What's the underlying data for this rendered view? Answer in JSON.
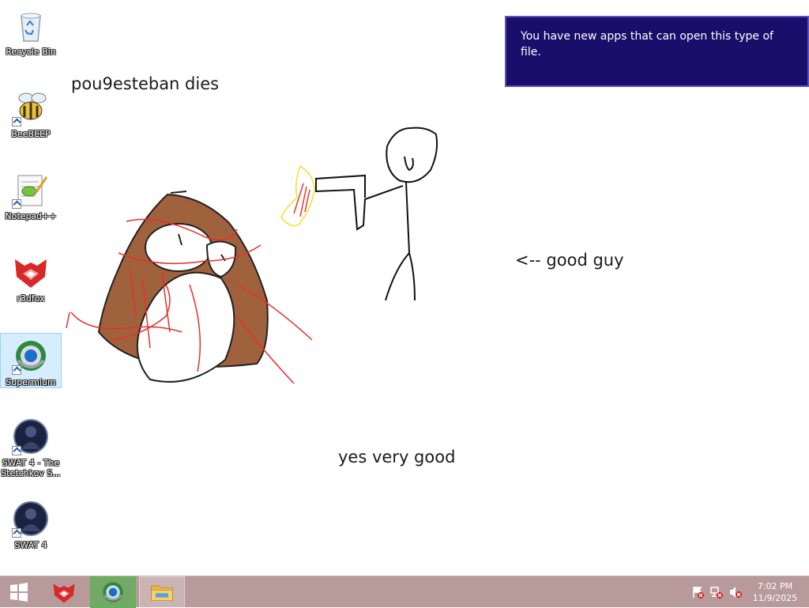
{
  "desktop": {
    "icons": [
      {
        "label": "Recycle Bin",
        "icon": "recycle-bin-icon"
      },
      {
        "label": "BeeBEEP",
        "icon": "bee-icon"
      },
      {
        "label": "Notepad++",
        "icon": "notepad-plus-plus-icon"
      },
      {
        "label": "r3dfox",
        "icon": "r3dfox-icon"
      },
      {
        "label": "Supermium",
        "icon": "supermium-icon"
      },
      {
        "label": "SWAT 4 - The Stetchkov S...",
        "icon": "swat4-stetchkov-icon"
      },
      {
        "label": "SWAT 4",
        "icon": "swat4-icon"
      }
    ]
  },
  "wallpaper": {
    "caption_top": "pou9esteban dies",
    "caption_right": "<-- good guy",
    "caption_bottom": "yes very good"
  },
  "toast": {
    "message": "You have new apps that can open this type of file."
  },
  "taskbar": {
    "start_icon": "windows-start-icon",
    "pinned": [
      "r3dfox-icon",
      "supermium-icon",
      "file-explorer-icon"
    ],
    "tray_icons": [
      "action-center-flag-icon",
      "network-icon",
      "volume-muted-icon"
    ],
    "time": "7:02 PM",
    "date": "11/9/2025"
  },
  "colors": {
    "taskbar": "#b89a9a",
    "toast_bg": "#1a0e6b",
    "pou_brown": "#a0613d"
  }
}
